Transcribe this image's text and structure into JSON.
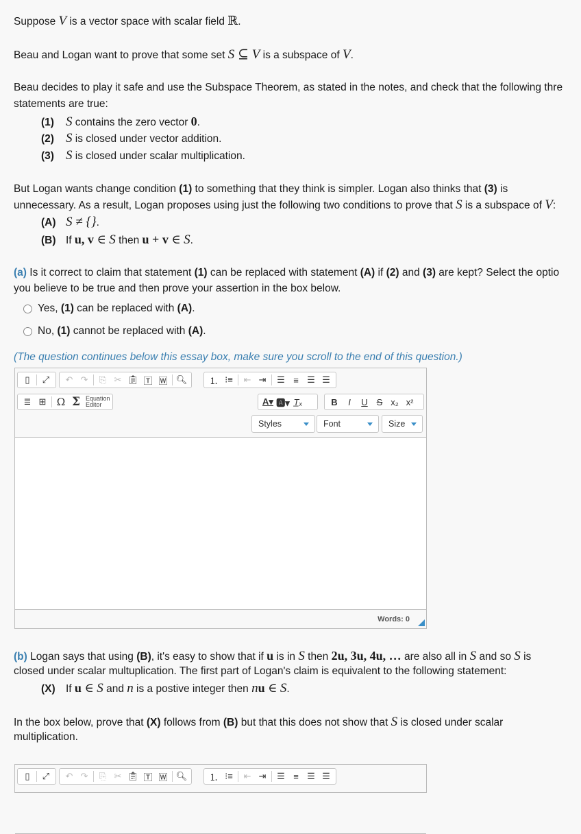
{
  "intro": {
    "line1_a": "Suppose ",
    "line1_V": "V",
    "line1_b": " is a vector space with scalar field ",
    "line1_R": "ℝ",
    "line1_c": ".",
    "line2_a": "Beau and Logan want to prove that some set ",
    "line2_math": "S ⊆ V",
    "line2_b": " is a subspace of ",
    "line2_V": "V",
    "line2_c": "."
  },
  "beau": {
    "text_line1": "Beau decides to play it safe and use the Subspace Theorem, as stated in the notes, and check that the following thre",
    "text_line2": "statements are true:",
    "conditions": [
      {
        "label": "(1)",
        "math": "S",
        "text": " contains the zero vector ",
        "bold_math": "0",
        "end": "."
      },
      {
        "label": "(2)",
        "math": "S",
        "text": " is closed under vector addition.",
        "bold_math": "",
        "end": ""
      },
      {
        "label": "(3)",
        "math": "S",
        "text": " is closed under scalar multiplication.",
        "bold_math": "",
        "end": ""
      }
    ]
  },
  "logan": {
    "l1_a": "But Logan wants change condition ",
    "l1_b1": "(1)",
    "l1_c": " to something that they think is simpler.  Logan also thinks that ",
    "l1_b3": "(3)",
    "l1_d": " is",
    "l2_a": "unnecessary.  As a result, Logan proposes using just the following two conditions to prove that ",
    "l2_S": "S",
    "l2_b": " is a subspace of ",
    "l2_V": "V",
    "l2_c": ":",
    "condA_label": "(A)",
    "condA_math": "S ≠ {}",
    "condA_end": ".",
    "condB_label": "(B)",
    "condB_if": "If ",
    "condB_uv": "u, v",
    "condB_in": " ∈ ",
    "condB_S": "S",
    "condB_then": " then ",
    "condB_upv": "u + v",
    "condB_in2": " ∈ ",
    "condB_S2": "S",
    "condB_end": "."
  },
  "part_a": {
    "label": "(a)",
    "q1": " Is it correct to claim that statement ",
    "b1": "(1)",
    "q2": " can be replaced with statement ",
    "bA": "(A)",
    "q3": " if ",
    "b2": "(2)",
    "q4": " and ",
    "b3": "(3)",
    "q5": " are kept?  Select the optio",
    "q6": "you believe to be true and then prove your assertion in the box below.",
    "options": [
      {
        "a": "Yes, ",
        "b": "(1)",
        "c": " can be replaced with ",
        "d": "(A)",
        "e": ".",
        "selected": false
      },
      {
        "a": "No, ",
        "b": "(1)",
        "c": " cannot be replaced with ",
        "d": "(A)",
        "e": ".",
        "selected": false
      }
    ],
    "note": "(The question continues below this essay box, make sure you scroll to the end of this question.)"
  },
  "editor": {
    "toolbar_icons": [
      "source-icon",
      "maximize-icon",
      "undo-icon",
      "redo-icon",
      "copy-icon",
      "cut-icon",
      "paste-icon",
      "paste-text-icon",
      "paste-word-icon",
      "find-icon",
      "numbered-list-icon",
      "bulleted-list-icon",
      "outdent-icon",
      "indent-icon",
      "align-left-icon",
      "align-center-icon",
      "align-right-icon",
      "justify-icon",
      "horizontal-rule-icon",
      "table-icon",
      "omega-icon",
      "sigma-icon",
      "text-color-icon",
      "background-color-icon",
      "remove-format-icon",
      "bold-icon",
      "italic-icon",
      "underline-icon",
      "strike-icon",
      "subscript-icon",
      "superscript-icon"
    ],
    "equation_label_1": "Equation",
    "equation_label_2": "Editor",
    "styles_label": "Styles",
    "font_label": "Font",
    "size_label": "Size",
    "content": "",
    "words_label": "Words: 0"
  },
  "part_b": {
    "label": "(b)",
    "l1_a": " Logan says that using ",
    "l1_B": "(B)",
    "l1_b": ", it's easy to show that if ",
    "l1_u": "u",
    "l1_c": " is in ",
    "l1_S": "S",
    "l1_d": " then ",
    "l1_seq": "2u, 3u, 4u, …",
    "l1_e": " are also all in ",
    "l1_S2": "S",
    "l1_f": " and so ",
    "l1_S3": "S",
    "l1_g": " is",
    "l2": "closed under scalar multuplication.  The first part of Logan's claim is equivalent to the following statement:",
    "condX_label": "(X)",
    "condX_if": "If ",
    "condX_u": "u",
    "condX_in": " ∈ ",
    "condX_S": "S",
    "condX_and": " and ",
    "condX_n": "n",
    "condX_text": " is a postive integer then ",
    "condX_nu": "n",
    "condX_nu_b": "u",
    "condX_in2": " ∈ ",
    "condX_S2": "S",
    "condX_end": ".",
    "p1_a": "In the box below, prove that ",
    "p1_X": "(X)",
    "p1_b": " follows from ",
    "p1_B": "(B)",
    "p1_c": " but that this does not show that ",
    "p1_S": "S",
    "p1_d": " is closed under scalar",
    "p2": "multiplication."
  }
}
